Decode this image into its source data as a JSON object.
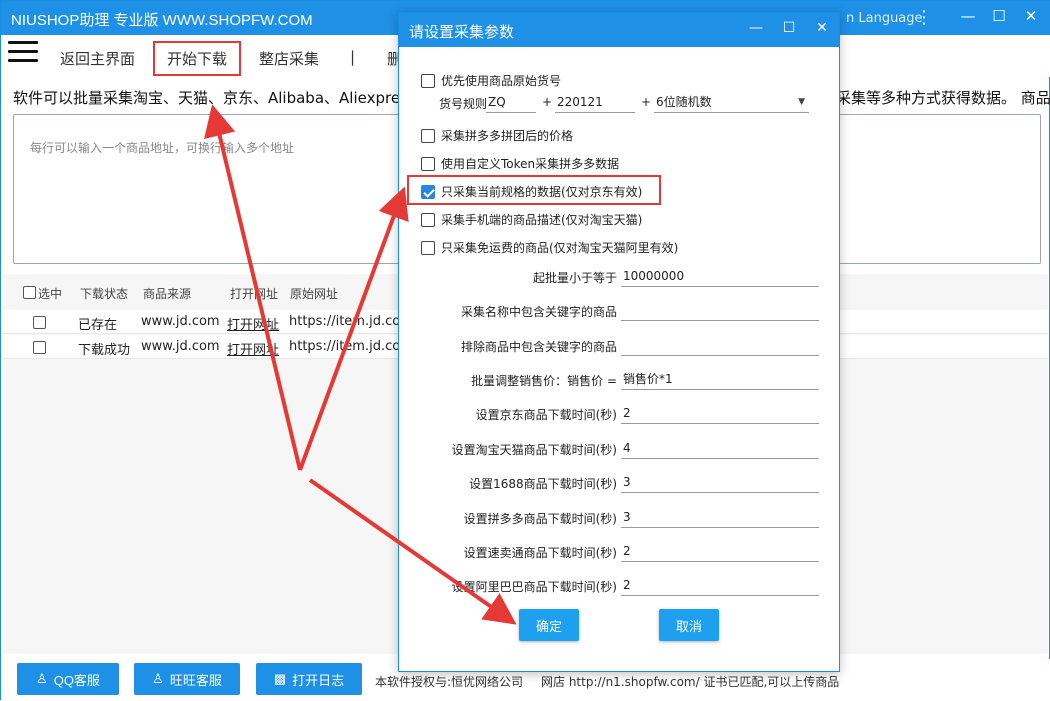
{
  "titlebar": {
    "title": "NIUSHOP助理 专业版 WWW.SHOPFW.COM",
    "language": "n Language",
    "kebab": "⋮",
    "minimize": "—",
    "maximize": "☐",
    "close": "✕"
  },
  "menu": {
    "items": [
      "返回主界面",
      "开始下载",
      "整店采集",
      "|",
      "删"
    ]
  },
  "description": {
    "left": "软件可以批量采集淘宝、天猫、京东、Alibaba、Aliexpres",
    "right": "采集等多种方式获得数据。 商品"
  },
  "url_input": {
    "placeholder": "每行可以输入一个商品地址，可换行输入多个地址"
  },
  "list": {
    "headers": [
      "选中",
      "下载状态",
      "商品来源",
      "打开网址",
      "原始网址"
    ],
    "rows": [
      {
        "status": "已存在",
        "source": "www.jd.com",
        "open": "打开网址",
        "url": "https://item.jd.com"
      },
      {
        "status": "下载成功",
        "source": "www.jd.com",
        "open": "打开网址",
        "url": "https://item.jd.com"
      }
    ]
  },
  "bottom": {
    "qq": "QQ客服",
    "wangwang": "旺旺客服",
    "log": "打开日志",
    "license": "本软件授权与:恒优网络公司",
    "shop": "网店 http://n1.shopfw.com/ 证书已匹配,可以上传商品"
  },
  "dialog": {
    "title": "请设置采集参数",
    "min": "—",
    "max": "☐",
    "close": "✕",
    "opt_original_sku": "优先使用商品原始货号",
    "sku_rule_label": "货号规则",
    "sku_rule_value": "ZQ",
    "plus1": "+",
    "sku_date": "220121",
    "plus2": "+",
    "sku_random": "6位随机数",
    "opt_pdd_group": "采集拼多多拼团后的价格",
    "opt_pdd_token": "使用自定义Token采集拼多多数据",
    "opt_current_spec": "只采集当前规格的数据(仅对京东有效)",
    "opt_mobile_desc": "采集手机端的商品描述(仅对淘宝天猫)",
    "opt_free_ship": "只采集免运费的商品(仅对淘宝天猫阿里有效)",
    "fields": [
      {
        "label": "起批量小于等于",
        "value": "10000000"
      },
      {
        "label": "采集名称中包含关键字的商品",
        "value": ""
      },
      {
        "label": "排除商品中包含关键字的商品",
        "value": ""
      },
      {
        "label": "批量调整销售价：销售价 =",
        "value": "销售价*1"
      },
      {
        "label": "设置京东商品下载时间(秒)",
        "value": "2"
      },
      {
        "label": "设置淘宝天猫商品下载时间(秒)",
        "value": "4"
      },
      {
        "label": "设置1688商品下载时间(秒)",
        "value": "3"
      },
      {
        "label": "设置拼多多商品下载时间(秒)",
        "value": "3"
      },
      {
        "label": "设置速卖通商品下载时间(秒)",
        "value": "2"
      },
      {
        "label": "设置阿里巴巴商品下载时间(秒)",
        "value": "2"
      }
    ],
    "ok": "确定",
    "cancel": "取消"
  },
  "colors": {
    "accent": "#1e90e6",
    "highlight": "#e53935"
  }
}
